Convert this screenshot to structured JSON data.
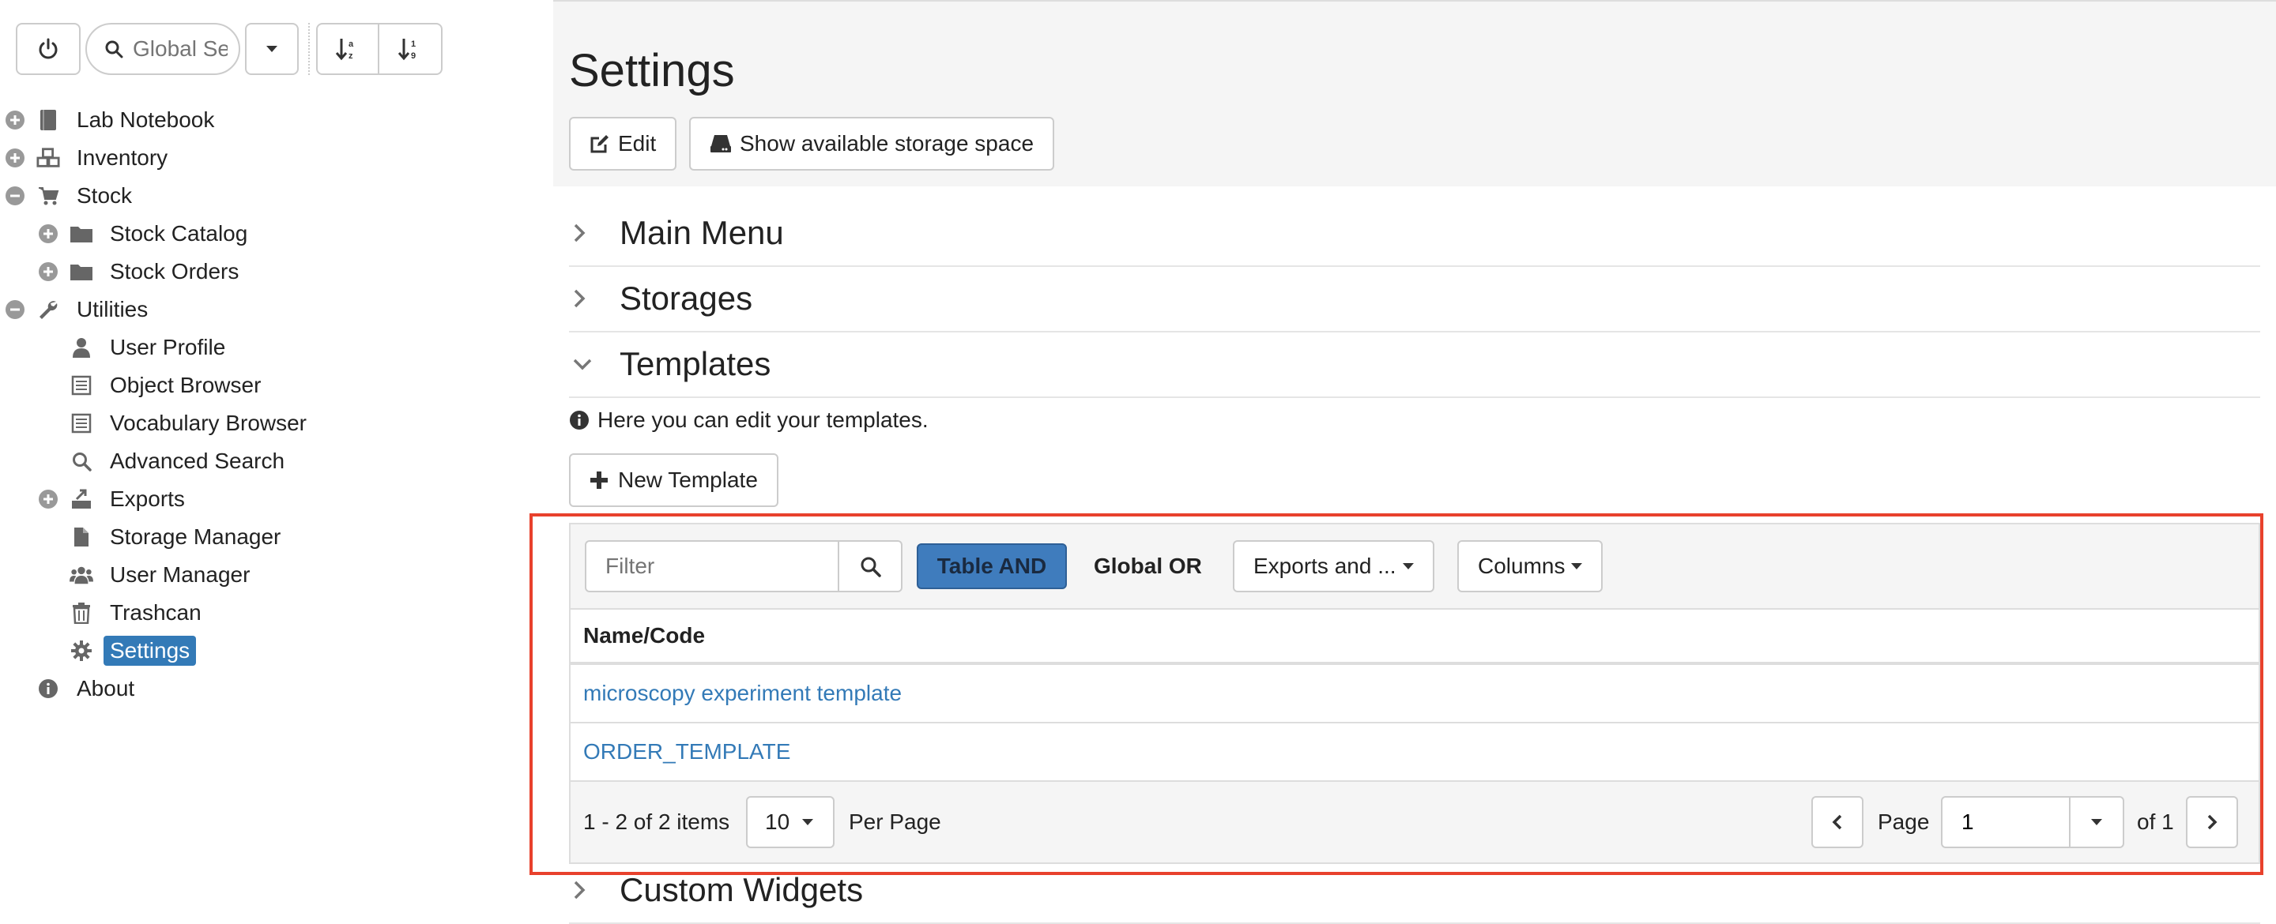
{
  "toolbar": {
    "search_placeholder": "Global Search"
  },
  "tree": {
    "items": [
      {
        "label": "Lab Notebook"
      },
      {
        "label": "Inventory"
      },
      {
        "label": "Stock"
      },
      {
        "label": "Stock Catalog"
      },
      {
        "label": "Stock Orders"
      },
      {
        "label": "Utilities"
      },
      {
        "label": "User Profile"
      },
      {
        "label": "Object Browser"
      },
      {
        "label": "Vocabulary Browser"
      },
      {
        "label": "Advanced Search"
      },
      {
        "label": "Exports"
      },
      {
        "label": "Storage Manager"
      },
      {
        "label": "User Manager"
      },
      {
        "label": "Trashcan"
      },
      {
        "label": "Settings"
      },
      {
        "label": "About"
      }
    ]
  },
  "header": {
    "title": "Settings",
    "edit_label": "Edit",
    "storage_label": "Show available storage space"
  },
  "sections": {
    "main_menu": "Main Menu",
    "storages": "Storages",
    "templates": "Templates",
    "custom_widgets": "Custom Widgets"
  },
  "templates": {
    "info": "Here you can edit your templates.",
    "new_label": "New Template",
    "grid": {
      "filter_placeholder": "Filter",
      "table_and": "Table AND",
      "global_or": "Global OR",
      "exports_label": "Exports and ...",
      "columns_label": "Columns",
      "header": "Name/Code",
      "rows": [
        {
          "name": "microscopy experiment template"
        },
        {
          "name": "ORDER_TEMPLATE"
        }
      ],
      "pager": {
        "count": "1 - 2 of 2 items",
        "page_size": "10",
        "per_page": "Per Page",
        "page_label": "Page",
        "page_value": "1",
        "of_label": "of 1"
      }
    }
  },
  "colors": {
    "accent": "#337ab7",
    "highlight": "#e8412c"
  }
}
